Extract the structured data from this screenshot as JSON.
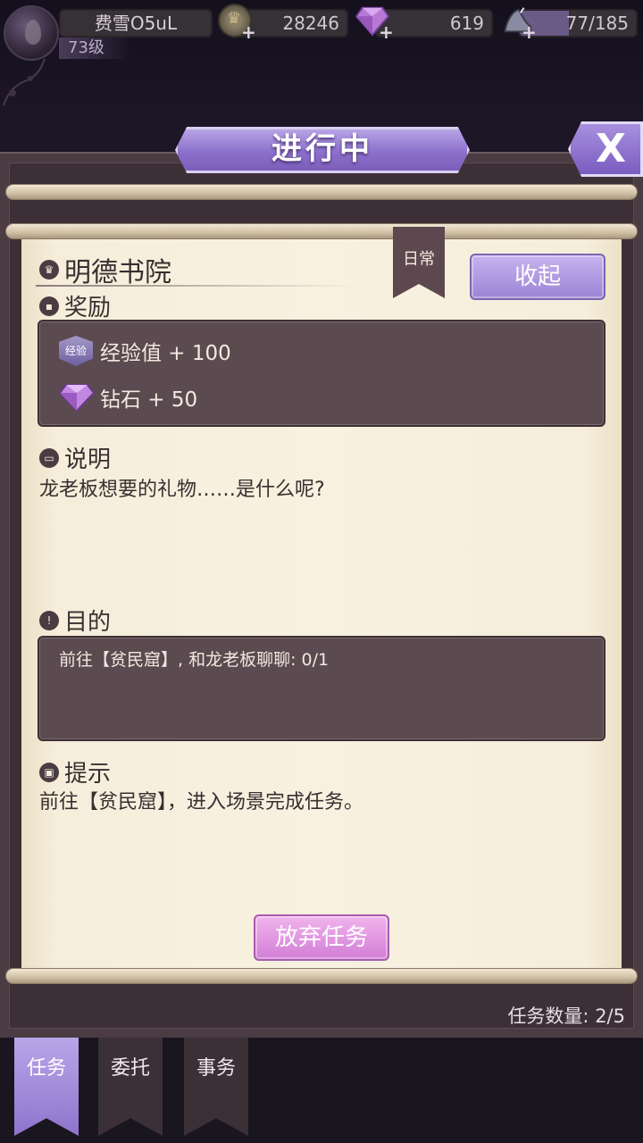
{
  "player": {
    "name": "费雪O5uL",
    "level": "73级"
  },
  "resources": {
    "gold": "28246",
    "diamond": "619",
    "stamina": "77/185",
    "stamina_fill": 0.42
  },
  "header": {
    "title": "进行中",
    "close_label": "X"
  },
  "quest": {
    "name": "明德书院",
    "type_tag": "日常",
    "collapse_label": "收起",
    "reward_heading": "奖励",
    "rewards": [
      {
        "icon": "exp-badge-icon",
        "badge_text": "经验",
        "label": "经验值 + 100"
      },
      {
        "icon": "diamond-icon",
        "label": "钻石 + 50"
      }
    ],
    "desc_heading": "说明",
    "description": "龙老板想要的礼物……是什么呢?",
    "goal_heading": "目的",
    "goal": "前往【贫民窟】, 和龙老板聊聊: 0/1",
    "hint_heading": "提示",
    "hint": "前往【贫民窟】，进入场景完成任务。",
    "abandon_label": "放弃任务"
  },
  "footer": {
    "quest_count": "任务数量:  2/5"
  },
  "tabs": [
    {
      "label": "任务",
      "active": true
    },
    {
      "label": "委托",
      "active": false
    },
    {
      "label": "事务",
      "active": false
    }
  ],
  "colors": {
    "accent_purple": "#9c84d6",
    "abandon_pink": "#d27ed6",
    "parchment": "#f8f1e0",
    "panel_dark": "#5b4a50"
  }
}
